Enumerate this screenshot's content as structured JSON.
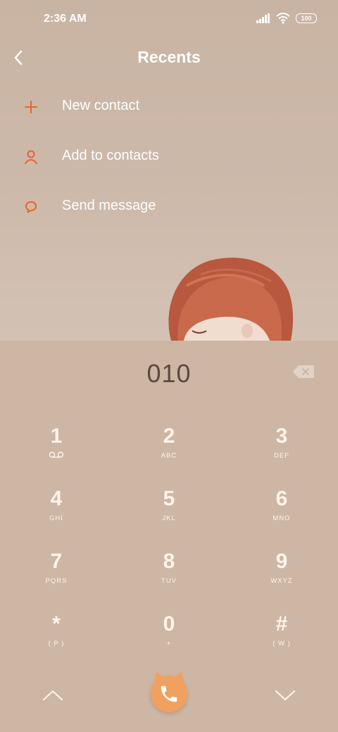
{
  "status_bar": {
    "time": "2:36 AM",
    "battery": "100",
    "icons": [
      "signal-icon",
      "wifi-icon",
      "battery-icon"
    ]
  },
  "header": {
    "title": "Recents",
    "back_icon": "chevron-left-icon"
  },
  "menu": [
    {
      "label": "New contact",
      "icon": "plus-icon"
    },
    {
      "label": "Add to contacts",
      "icon": "person-icon"
    },
    {
      "label": "Send message",
      "icon": "chat-bubble-icon"
    }
  ],
  "dialer": {
    "number": "010",
    "backspace_icon": "backspace-icon",
    "keys": [
      {
        "digit": "1",
        "sub": ""
      },
      {
        "digit": "2",
        "sub": "ABC"
      },
      {
        "digit": "3",
        "sub": "DEF"
      },
      {
        "digit": "4",
        "sub": "GHI"
      },
      {
        "digit": "5",
        "sub": "JKL"
      },
      {
        "digit": "6",
        "sub": "MNO"
      },
      {
        "digit": "7",
        "sub": "PQRS"
      },
      {
        "digit": "8",
        "sub": "TUV"
      },
      {
        "digit": "9",
        "sub": "WXYZ"
      },
      {
        "digit": "*",
        "sub": "( P )"
      },
      {
        "digit": "0",
        "sub": "+"
      },
      {
        "digit": "#",
        "sub": "( W )"
      }
    ]
  },
  "bottom_bar": {
    "left_icon": "chevron-up-icon",
    "call_icon": "phone-icon",
    "right_icon": "chevron-down-icon"
  },
  "colors": {
    "background": "#cdb6a4",
    "accent": "#e8642c",
    "call_button": "#f0a15f",
    "number_text": "#5b4a40"
  }
}
